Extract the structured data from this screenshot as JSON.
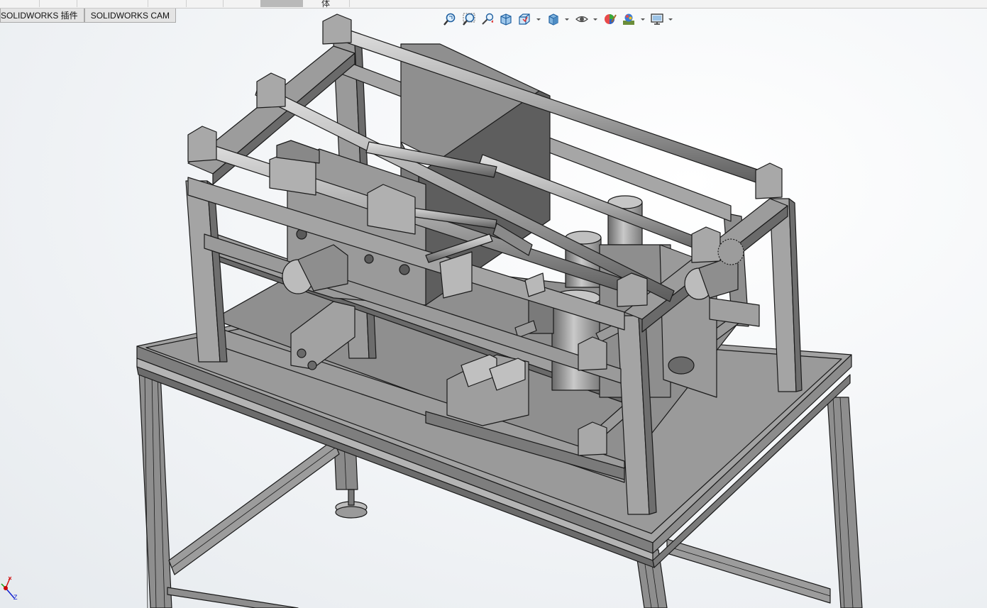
{
  "top_strip": {
    "fragment": "体"
  },
  "tabs": [
    {
      "label": "SOLIDWORKS 插件"
    },
    {
      "label": "SOLIDWORKS CAM"
    }
  ],
  "view_toolbar": {
    "items": [
      {
        "icon": "zoom-to-fit-icon"
      },
      {
        "icon": "zoom-to-area-icon"
      },
      {
        "icon": "previous-view-icon"
      },
      {
        "icon": "section-view-icon"
      },
      {
        "icon": "view-orientation-icon",
        "dropdown": true
      },
      {
        "icon": "display-style-icon",
        "dropdown": true
      },
      {
        "icon": "hide-show-items-icon",
        "dropdown": true
      },
      {
        "icon": "edit-appearance-icon"
      },
      {
        "icon": "apply-scene-icon",
        "dropdown": true
      },
      {
        "icon": "view-settings-icon",
        "dropdown": true
      }
    ]
  },
  "triad": {
    "axis_label": "Z"
  },
  "colors": {
    "model_face": "#9a9a9a",
    "model_dark": "#5c5c5c",
    "model_light": "#c4c4c4",
    "edge": "#1a1a1a",
    "axis_x": "#d01010",
    "axis_y": "#10a010",
    "axis_z": "#1020d0"
  }
}
